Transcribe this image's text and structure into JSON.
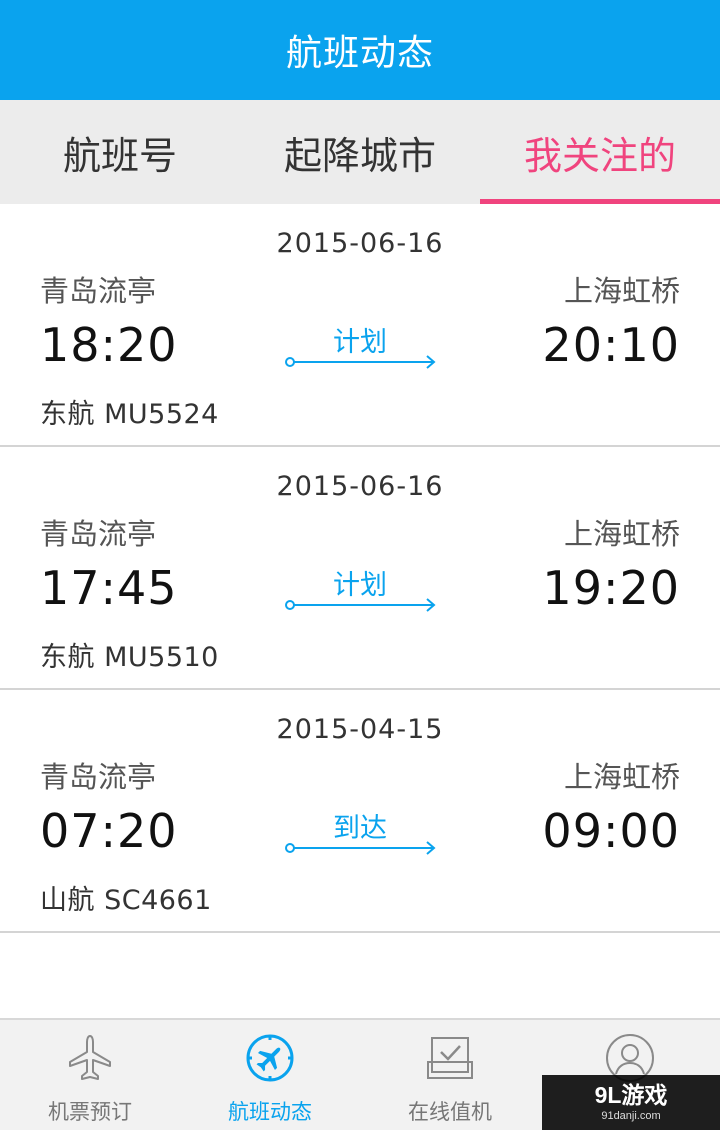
{
  "header": {
    "title": "航班动态"
  },
  "tabs": [
    {
      "label": "航班号",
      "active": false
    },
    {
      "label": "起降城市",
      "active": false
    },
    {
      "label": "我关注的",
      "active": true
    }
  ],
  "flights": [
    {
      "date": "2015-06-16",
      "dep_city": "青岛流亭",
      "arr_city": "上海虹桥",
      "dep_time": "18:20",
      "arr_time": "20:10",
      "status": "计划",
      "airline": "东航 MU5524"
    },
    {
      "date": "2015-06-16",
      "dep_city": "青岛流亭",
      "arr_city": "上海虹桥",
      "dep_time": "17:45",
      "arr_time": "19:20",
      "status": "计划",
      "airline": "东航 MU5510"
    },
    {
      "date": "2015-04-15",
      "dep_city": "青岛流亭",
      "arr_city": "上海虹桥",
      "dep_time": "07:20",
      "arr_time": "09:00",
      "status": "到达",
      "airline": "山航 SC4661"
    }
  ],
  "bottom_nav": [
    {
      "label": "机票预订",
      "icon": "airplane-icon",
      "active": false
    },
    {
      "label": "航班动态",
      "icon": "compass-plane-icon",
      "active": true
    },
    {
      "label": "在线值机",
      "icon": "checkin-icon",
      "active": false
    },
    {
      "label": "",
      "icon": "user-icon",
      "active": false
    }
  ],
  "watermark": {
    "main": "9L游戏",
    "sub": "91danji.com"
  },
  "colors": {
    "primary": "#0aa3ee",
    "accent": "#f0447e",
    "tab_bg": "#ececec",
    "nav_bg": "#f2f2f2"
  }
}
